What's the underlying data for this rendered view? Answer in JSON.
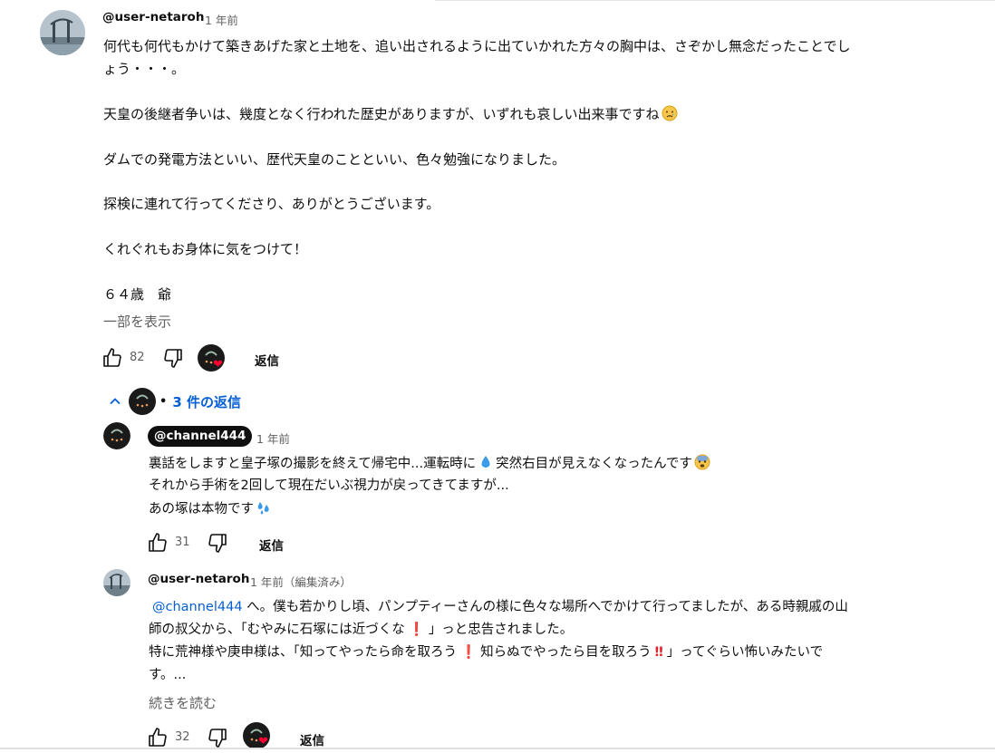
{
  "main_comment": {
    "author": "@user-netaroh",
    "time": "1 年前",
    "lines": [
      "何代も何代もかけて築きあげた家と土地を、追い出されるように出ていかれた方々の胸中は、さぞかし無念だったことでし",
      "ょう・・・。",
      "天皇の後継者争いは、幾度となく行われた歴史がありますが、いずれも哀しい出来事ですね",
      "ダムでの発電方法といい、歴代天皇のことといい、色々勉強になりました。",
      "探検に連れて行ってくださり、ありがとうございます。",
      "くれぐれもお身体に気をつけて！",
      "６４歳　爺"
    ],
    "show_more": "一部を表示",
    "like_count": "82",
    "reply_label": "返信"
  },
  "replies_toggle": {
    "label": "3 件の返信",
    "dot": "•"
  },
  "reply1": {
    "author": "@channel444",
    "time": "1 年前",
    "line1_a": "裏話をしますと皇子塚の撮影を終えて帰宅中...運転時に",
    "line1_b": "突然右目が見えなくなったんです",
    "line2": "それから手術を2回して現在だいぶ視力が戻ってきてますが...",
    "line3": "あの塚は本物です",
    "like_count": "31",
    "reply_label": "返信"
  },
  "reply2": {
    "author": "@user-netaroh",
    "time": "1 年前（編集済み）",
    "mention": "@channel444",
    "line1_rest": " へ。僕も若かりし頃、パンプティーさんの様に色々な場所へでかけて行ってましたが、ある時親戚の山",
    "line2_a": "師の叔父から、「むやみに石塚には近づくな",
    "line2_b": "」っと忠告されました。",
    "line3_a": "特に荒神様や庚申様は、「知ってやったら命を取ろう",
    "line3_b": "知らぬでやったら目を取ろう",
    "line3_c": "」ってぐらい怖いみたいで",
    "line4": "す。...",
    "read_more": "続きを読む",
    "like_count": "32",
    "reply_label": "返信"
  },
  "icons": {
    "like": "thumbs-up-icon",
    "dislike": "thumbs-down-icon",
    "creator_heart": "heart-icon",
    "chevron": "chevron-up-icon",
    "exclamation": "❗",
    "double_exclamation": "‼"
  },
  "colors": {
    "link": "#065fd4",
    "secondary": "#606060",
    "heart": "#ff0033"
  }
}
